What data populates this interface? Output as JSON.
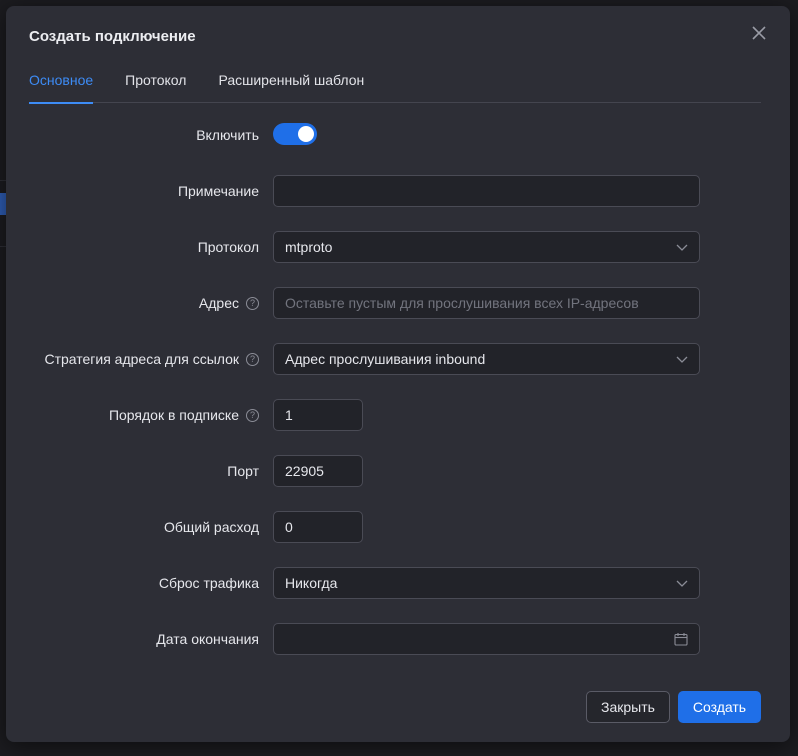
{
  "dialog": {
    "title": "Создать подключение",
    "close_icon": "close-icon"
  },
  "tabs": [
    {
      "label": "Основное",
      "active": true
    },
    {
      "label": "Протокол",
      "active": false
    },
    {
      "label": "Расширенный шаблон",
      "active": false
    }
  ],
  "form": {
    "enable": {
      "label": "Включить",
      "value": true
    },
    "remark": {
      "label": "Примечание",
      "value": "",
      "placeholder": ""
    },
    "protocol": {
      "label": "Протокол",
      "value": "mtproto"
    },
    "address": {
      "label": "Адрес",
      "value": "",
      "placeholder": "Оставьте пустым для прослушивания всех IP-адресов",
      "help": "?"
    },
    "link_strategy": {
      "label": "Стратегия адреса для ссылок",
      "value": "Адрес прослушивания inbound",
      "help": "?"
    },
    "sub_order": {
      "label": "Порядок в подписке",
      "value": "1",
      "help": "?"
    },
    "port": {
      "label": "Порт",
      "value": "22905"
    },
    "total_usage": {
      "label": "Общий расход",
      "value": "0"
    },
    "traffic_reset": {
      "label": "Сброс трафика",
      "value": "Никогда"
    },
    "expiry_date": {
      "label": "Дата окончания",
      "value": "",
      "placeholder": ""
    }
  },
  "footer": {
    "close_label": "Закрыть",
    "create_label": "Создать"
  },
  "colors": {
    "accent": "#1f6fe8",
    "tab_active": "#3d8cf6",
    "modal_bg": "#2d2e36",
    "input_bg": "#222329"
  }
}
